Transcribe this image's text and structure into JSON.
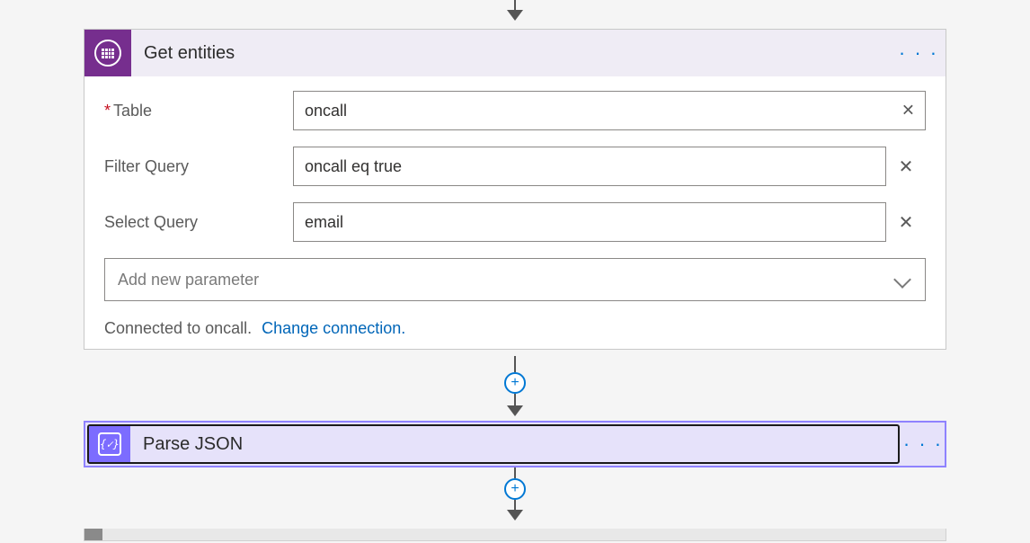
{
  "card1": {
    "title": "Get entities",
    "menu_glyph": "· · ·",
    "fields": {
      "table": {
        "label": "Table",
        "required": true,
        "value": "oncall"
      },
      "filter": {
        "label": "Filter Query",
        "required": false,
        "value": "oncall eq true"
      },
      "select": {
        "label": "Select Query",
        "required": false,
        "value": "email"
      }
    },
    "add_param_placeholder": "Add new parameter",
    "connected_text": "Connected to oncall.",
    "change_link": "Change connection."
  },
  "card2": {
    "title": "Parse JSON",
    "icon_text": "{✓}",
    "menu_glyph": "· · ·"
  },
  "glyphs": {
    "plus": "+",
    "clear": "✕"
  }
}
